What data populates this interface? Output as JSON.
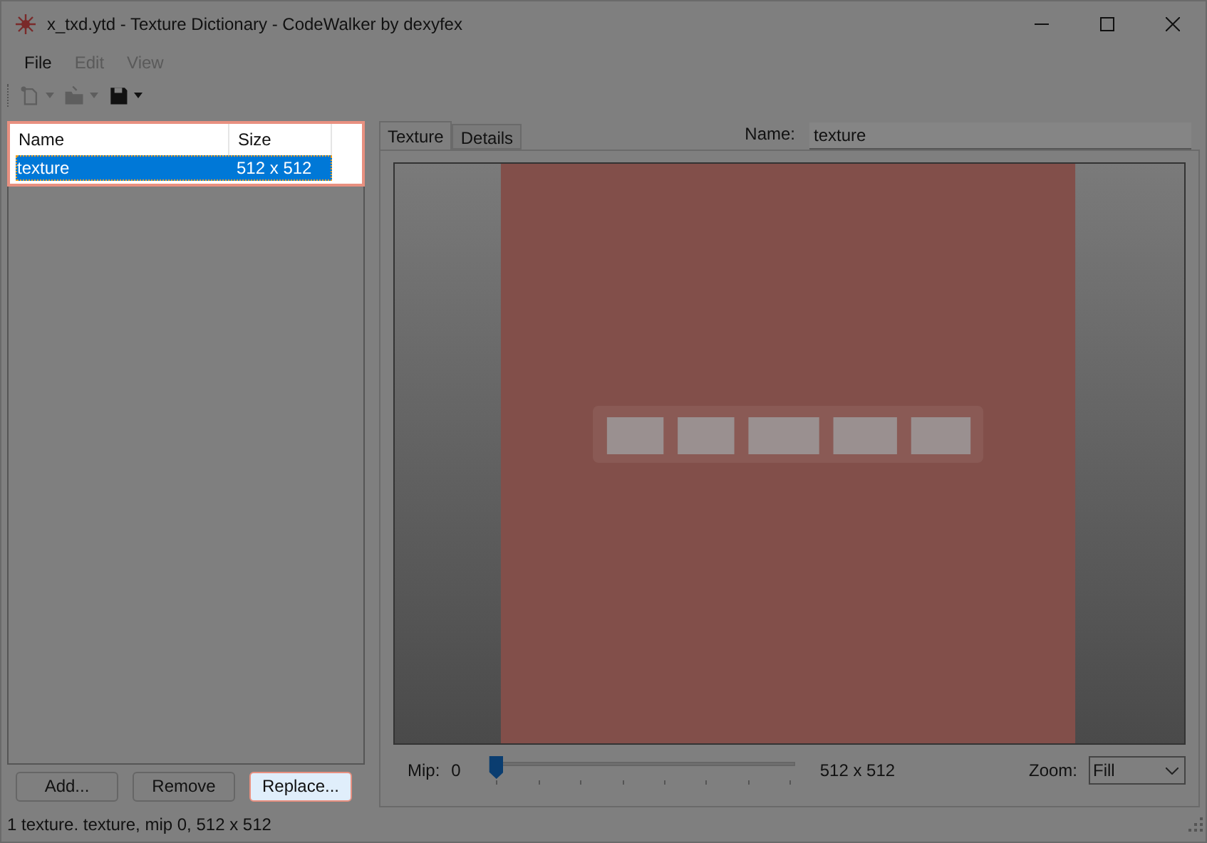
{
  "window": {
    "title": "x_txd.ytd - Texture Dictionary - CodeWalker by dexyfex"
  },
  "menu": [
    {
      "label": "File",
      "disabled": false
    },
    {
      "label": "Edit",
      "disabled": true
    },
    {
      "label": "View",
      "disabled": true
    }
  ],
  "toolbar": [
    {
      "kind": "new",
      "disabled": true
    },
    {
      "kind": "open",
      "disabled": true
    },
    {
      "kind": "save",
      "disabled": false
    }
  ],
  "texture_list": {
    "highlighted": true,
    "columns": [
      "Name",
      "Size"
    ],
    "rows": [
      {
        "name": "texture",
        "size": "512 x 512",
        "selected": true
      }
    ]
  },
  "buttons": [
    {
      "label": "Add...",
      "highlighted": false
    },
    {
      "label": "Remove",
      "highlighted": false
    },
    {
      "label": "Replace...",
      "highlighted": true
    }
  ],
  "tabs": [
    {
      "label": "Texture",
      "selected": true
    },
    {
      "label": "Details",
      "selected": false
    }
  ],
  "name_field": {
    "label": "Name:",
    "value": "texture"
  },
  "mip": {
    "label": "Mip:",
    "value": "0",
    "level": 0,
    "size": "512 x 512"
  },
  "zoom": {
    "label": "Zoom:",
    "value": "Fill"
  },
  "status_bar": "1 texture. texture, mip 0, 512 x 512"
}
